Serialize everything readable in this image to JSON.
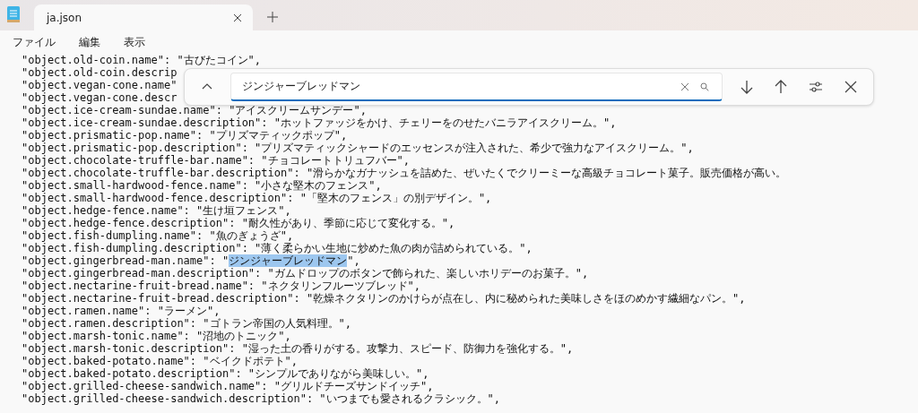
{
  "tabs": [
    {
      "title": "ja.json",
      "selected": true
    }
  ],
  "menu": [
    "ファイル",
    "編集",
    "表示"
  ],
  "find": {
    "value": "ジンジャーブレッドマン"
  },
  "lines": [
    {
      "kind": "plain",
      "text": "\"object.old-coin.name\": \"古びたコイン\","
    },
    {
      "kind": "plain",
      "text": "\"object.old-coin.descrip"
    },
    {
      "kind": "plain",
      "text": "\"object.vegan-cone.name\""
    },
    {
      "kind": "plain",
      "text": "\"object.vegan-cone.descr"
    },
    {
      "kind": "plain",
      "text": "\"object.ice-cream-sundae.name\": \"アイスクリームサンデー\","
    },
    {
      "kind": "plain",
      "text": "\"object.ice-cream-sundae.description\": \"ホットファッジをかけ、チェリーをのせたバニラアイスクリーム。\","
    },
    {
      "kind": "plain",
      "text": "\"object.prismatic-pop.name\": \"プリズマティックポップ\","
    },
    {
      "kind": "plain",
      "text": "\"object.prismatic-pop.description\": \"プリズマティックシャードのエッセンスが注入された、希少で強力なアイスクリーム。\","
    },
    {
      "kind": "plain",
      "text": "\"object.chocolate-truffle-bar.name\": \"チョコレートトリュフバー\","
    },
    {
      "kind": "plain",
      "text": "\"object.chocolate-truffle-bar.description\": \"滑らかなガナッシュを詰めた、ぜいたくでクリーミーな高級チョコレート菓子。販売価格が高い。"
    },
    {
      "kind": "plain",
      "text": "\"object.small-hardwood-fence.name\": \"小さな堅木のフェンス\","
    },
    {
      "kind": "plain",
      "text": "\"object.small-hardwood-fence.description\": \"「堅木のフェンス」の別デザイン。\","
    },
    {
      "kind": "plain",
      "text": "\"object.hedge-fence.name\": \"生け垣フェンス\","
    },
    {
      "kind": "plain",
      "text": "\"object.hedge-fence.description\": \"耐久性があり、季節に応じて変化する。\","
    },
    {
      "kind": "plain",
      "text": "\"object.fish-dumpling.name\": \"魚のぎょうざ\","
    },
    {
      "kind": "plain",
      "text": "\"object.fish-dumpling.description\": \"薄く柔らかい生地に炒めた魚の肉が詰められている。\","
    },
    {
      "kind": "match",
      "before": "\"object.gingerbread-man.name\": \"",
      "match": "ジンジャーブレッドマン",
      "after": "\","
    },
    {
      "kind": "plain",
      "text": "\"object.gingerbread-man.description\": \"ガムドロップのボタンで飾られた、楽しいホリデーのお菓子。\","
    },
    {
      "kind": "plain",
      "text": "\"object.nectarine-fruit-bread.name\": \"ネクタリンフルーツブレッド\","
    },
    {
      "kind": "plain",
      "text": "\"object.nectarine-fruit-bread.description\": \"乾燥ネクタリンのかけらが点在し、内に秘められた美味しさをほのめかす繊細なパン。\","
    },
    {
      "kind": "plain",
      "text": "\"object.ramen.name\": \"ラーメン\","
    },
    {
      "kind": "plain",
      "text": "\"object.ramen.description\": \"ゴトラン帝国の人気料理。\","
    },
    {
      "kind": "plain",
      "text": "\"object.marsh-tonic.name\": \"沼地のトニック\","
    },
    {
      "kind": "plain",
      "text": "\"object.marsh-tonic.description\": \"湿った土の香りがする。攻撃力、スピード、防御力を強化する。\","
    },
    {
      "kind": "plain",
      "text": "\"object.baked-potato.name\": \"ベイクドポテト\","
    },
    {
      "kind": "plain",
      "text": "\"object.baked-potato.description\": \"シンプルでありながら美味しい。\","
    },
    {
      "kind": "plain",
      "text": "\"object.grilled-cheese-sandwich.name\": \"グリルドチーズサンドイッチ\","
    },
    {
      "kind": "plain",
      "text": "\"object.grilled-cheese-sandwich.description\": \"いつまでも愛されるクラシック。\","
    }
  ]
}
